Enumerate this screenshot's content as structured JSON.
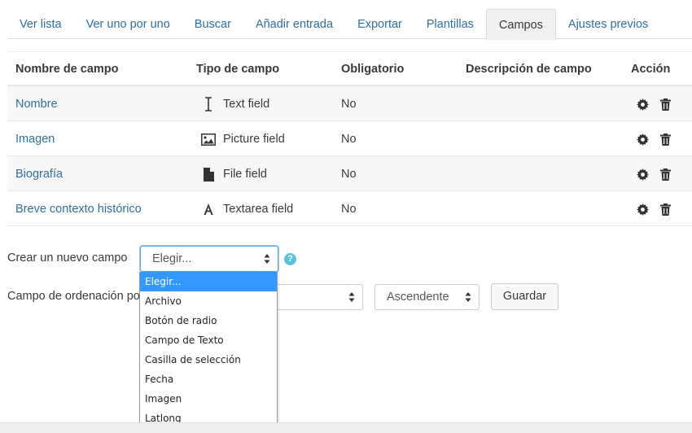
{
  "tabs": [
    {
      "label": "Ver lista"
    },
    {
      "label": "Ver uno por uno"
    },
    {
      "label": "Buscar"
    },
    {
      "label": "Añadir entrada"
    },
    {
      "label": "Exportar"
    },
    {
      "label": "Plantillas"
    },
    {
      "label": "Campos",
      "active": true
    },
    {
      "label": "Ajustes previos"
    }
  ],
  "table": {
    "headers": {
      "name": "Nombre de campo",
      "type": "Tipo de campo",
      "required": "Obligatorio",
      "description": "Descripción de campo",
      "action": "Acción"
    },
    "rows": [
      {
        "name": "Nombre",
        "type": "Text field",
        "type_icon": "text-cursor-icon",
        "required": "No",
        "description": ""
      },
      {
        "name": "Imagen",
        "type": "Picture field",
        "type_icon": "picture-icon",
        "required": "No",
        "description": ""
      },
      {
        "name": "Biografía",
        "type": "File field",
        "type_icon": "file-icon",
        "required": "No",
        "description": ""
      },
      {
        "name": "Breve contexto histórico",
        "type": "Textarea field",
        "type_icon": "textarea-icon",
        "required": "No",
        "description": ""
      }
    ]
  },
  "new_field": {
    "label": "Crear un nuevo campo",
    "selected": "Elegir...",
    "options": [
      "Elegir...",
      "Archivo",
      "Botón de radio",
      "Campo de Texto",
      "Casilla de selección",
      "Fecha",
      "Imagen",
      "Latlong"
    ]
  },
  "sort": {
    "label": "Campo de ordenación po",
    "order_selected": "Ascendente",
    "save_label": "Guardar"
  },
  "colors": {
    "link": "#2f6fa0",
    "highlight": "#3399ff",
    "help": "#5bc0de"
  }
}
